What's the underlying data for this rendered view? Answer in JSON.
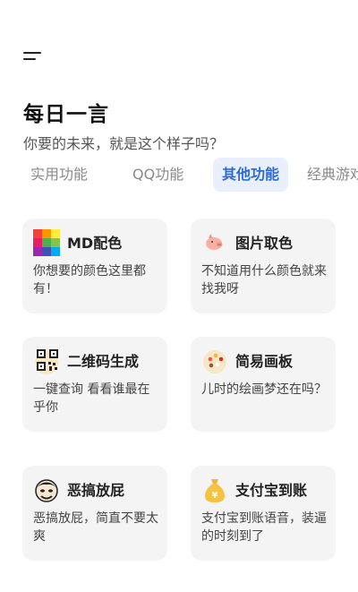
{
  "header": {
    "title": "每日一言",
    "subtitle": "你要的未来，就是这个样子吗？"
  },
  "tabs": [
    {
      "label": "实用功能",
      "active": false
    },
    {
      "label": "QQ功能",
      "active": false
    },
    {
      "label": "其他功能",
      "active": true
    },
    {
      "label": "经典游戏",
      "active": false
    }
  ],
  "colors": {
    "accent": "#2f6bd6",
    "active_tab_bg": "#e9effc",
    "card_bg": "#f4f4f4"
  },
  "features": [
    {
      "name": "MD配色",
      "desc": "你想要的颜色这里都有！",
      "icon": "color-palette-icon"
    },
    {
      "name": "图片取色",
      "desc": "不知道用什么颜色就来找我呀",
      "icon": "pig-icon"
    },
    {
      "name": "二维码生成",
      "desc": "一键查询 看看谁最在乎你",
      "icon": "qr-code-icon"
    },
    {
      "name": "简易画板",
      "desc": "儿时的绘画梦还在吗？",
      "icon": "paint-palette-icon"
    },
    {
      "name": "恶搞放屁",
      "desc": "恶搞放屁，简直不要太爽",
      "icon": "meme-face-icon"
    },
    {
      "name": "支付宝到账",
      "desc": "支付宝到账语音，装逼的时刻到了",
      "icon": "money-bag-icon"
    }
  ]
}
